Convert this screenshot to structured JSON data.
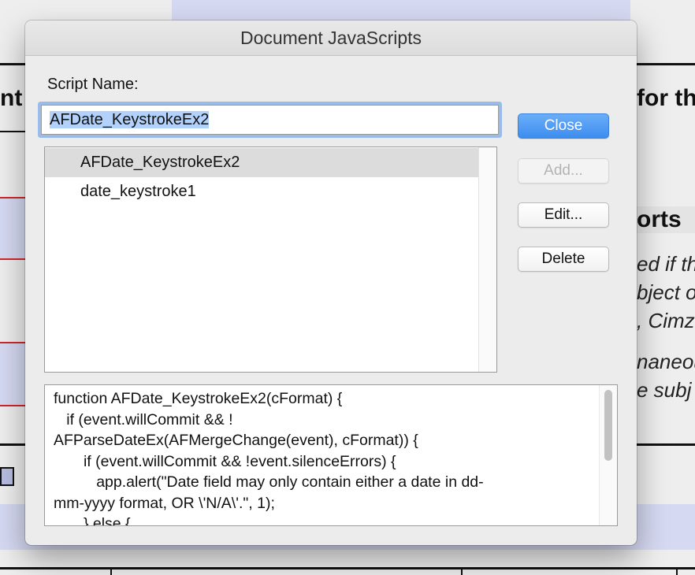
{
  "background": {
    "frag_left": "nt",
    "frag_for": "for th",
    "frag_heading": "orts",
    "frag_line1": "ed if th",
    "frag_line2": "bject o",
    "frag_line3": ", Cimz",
    "frag_line4": "naneous",
    "frag_line5": "e subj"
  },
  "dialog": {
    "title": "Document JavaScripts",
    "script_name_label": "Script Name:",
    "script_name_value": "AFDate_KeystrokeEx2",
    "scripts": [
      {
        "label": "AFDate_KeystrokeEx2",
        "selected": true
      },
      {
        "label": "date_keystroke1",
        "selected": false
      }
    ],
    "buttons": {
      "close": "Close",
      "add": "Add...",
      "edit": "Edit...",
      "delete": "Delete"
    },
    "code": "function AFDate_KeystrokeEx2(cFormat) {\n   if (event.willCommit && !\nAFParseDateEx(AFMergeChange(event), cFormat)) {\n       if (event.willCommit && !event.silenceErrors) {\n          app.alert(\"Date field may only contain either a date in dd-\nmm-yyyy format, OR \\'N/A\\'.\", 1);\n       } else {"
  },
  "colors": {
    "accent": "#3d8df0",
    "focus_ring": "#9bbcea",
    "doc_band": "#d6d9f2",
    "doc_redline": "#d0262a"
  }
}
